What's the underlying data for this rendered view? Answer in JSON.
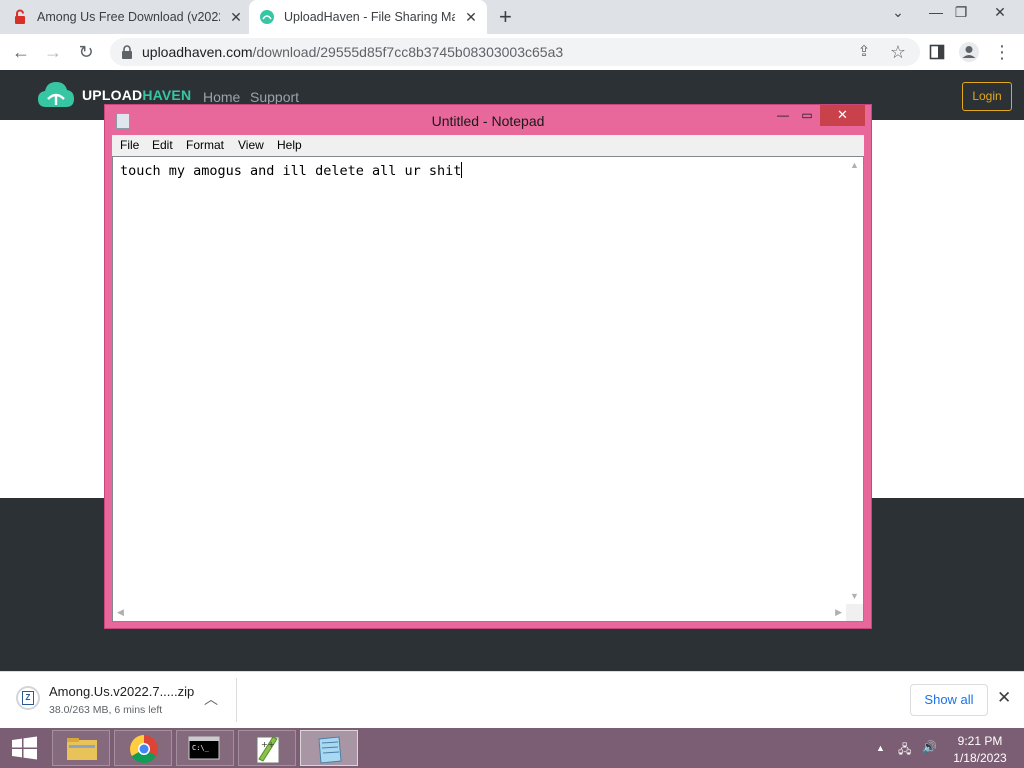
{
  "browser": {
    "tabs": [
      {
        "title": "Among Us Free Download (v2022.7",
        "close": "✕"
      },
      {
        "title": "UploadHaven - File Sharing Made",
        "close": "✕"
      }
    ],
    "new_tab": "+",
    "window_controls": {
      "dropdown": "⌄",
      "minimize": "—",
      "restore": "❐",
      "close": "✕"
    },
    "url_domain": "uploadhaven.com",
    "url_path": "/download/29555d85f7cc8b3745b08303003c65a3"
  },
  "site": {
    "logo_prefix": "UPLOAD",
    "logo_suffix": "HAVEN",
    "nav": [
      "Home",
      "Support"
    ],
    "login": "Login",
    "colors": {
      "header_bg": "#2c3135",
      "brand_green": "#36c6a3",
      "login_accent": "#e3a81b"
    }
  },
  "notepad": {
    "title": "Untitled - Notepad",
    "controls": {
      "minimize": "—",
      "maximize": "▭",
      "close": "✕"
    },
    "menu": [
      "File",
      "Edit",
      "Format",
      "View",
      "Help"
    ],
    "content": "touch my amogus and ill delete all ur shit",
    "frame_color": "#e8689b"
  },
  "downloads": {
    "file_name": "Among.Us.v2022.7.....zip",
    "status": "38.0/263 MB, 6 mins left",
    "show_all": "Show all",
    "close": "✕"
  },
  "taskbar": {
    "time": "9:21 PM",
    "date": "1/18/2023",
    "apps": [
      "file-explorer",
      "chrome",
      "command-prompt",
      "notepad-plus-plus",
      "notepad"
    ]
  }
}
